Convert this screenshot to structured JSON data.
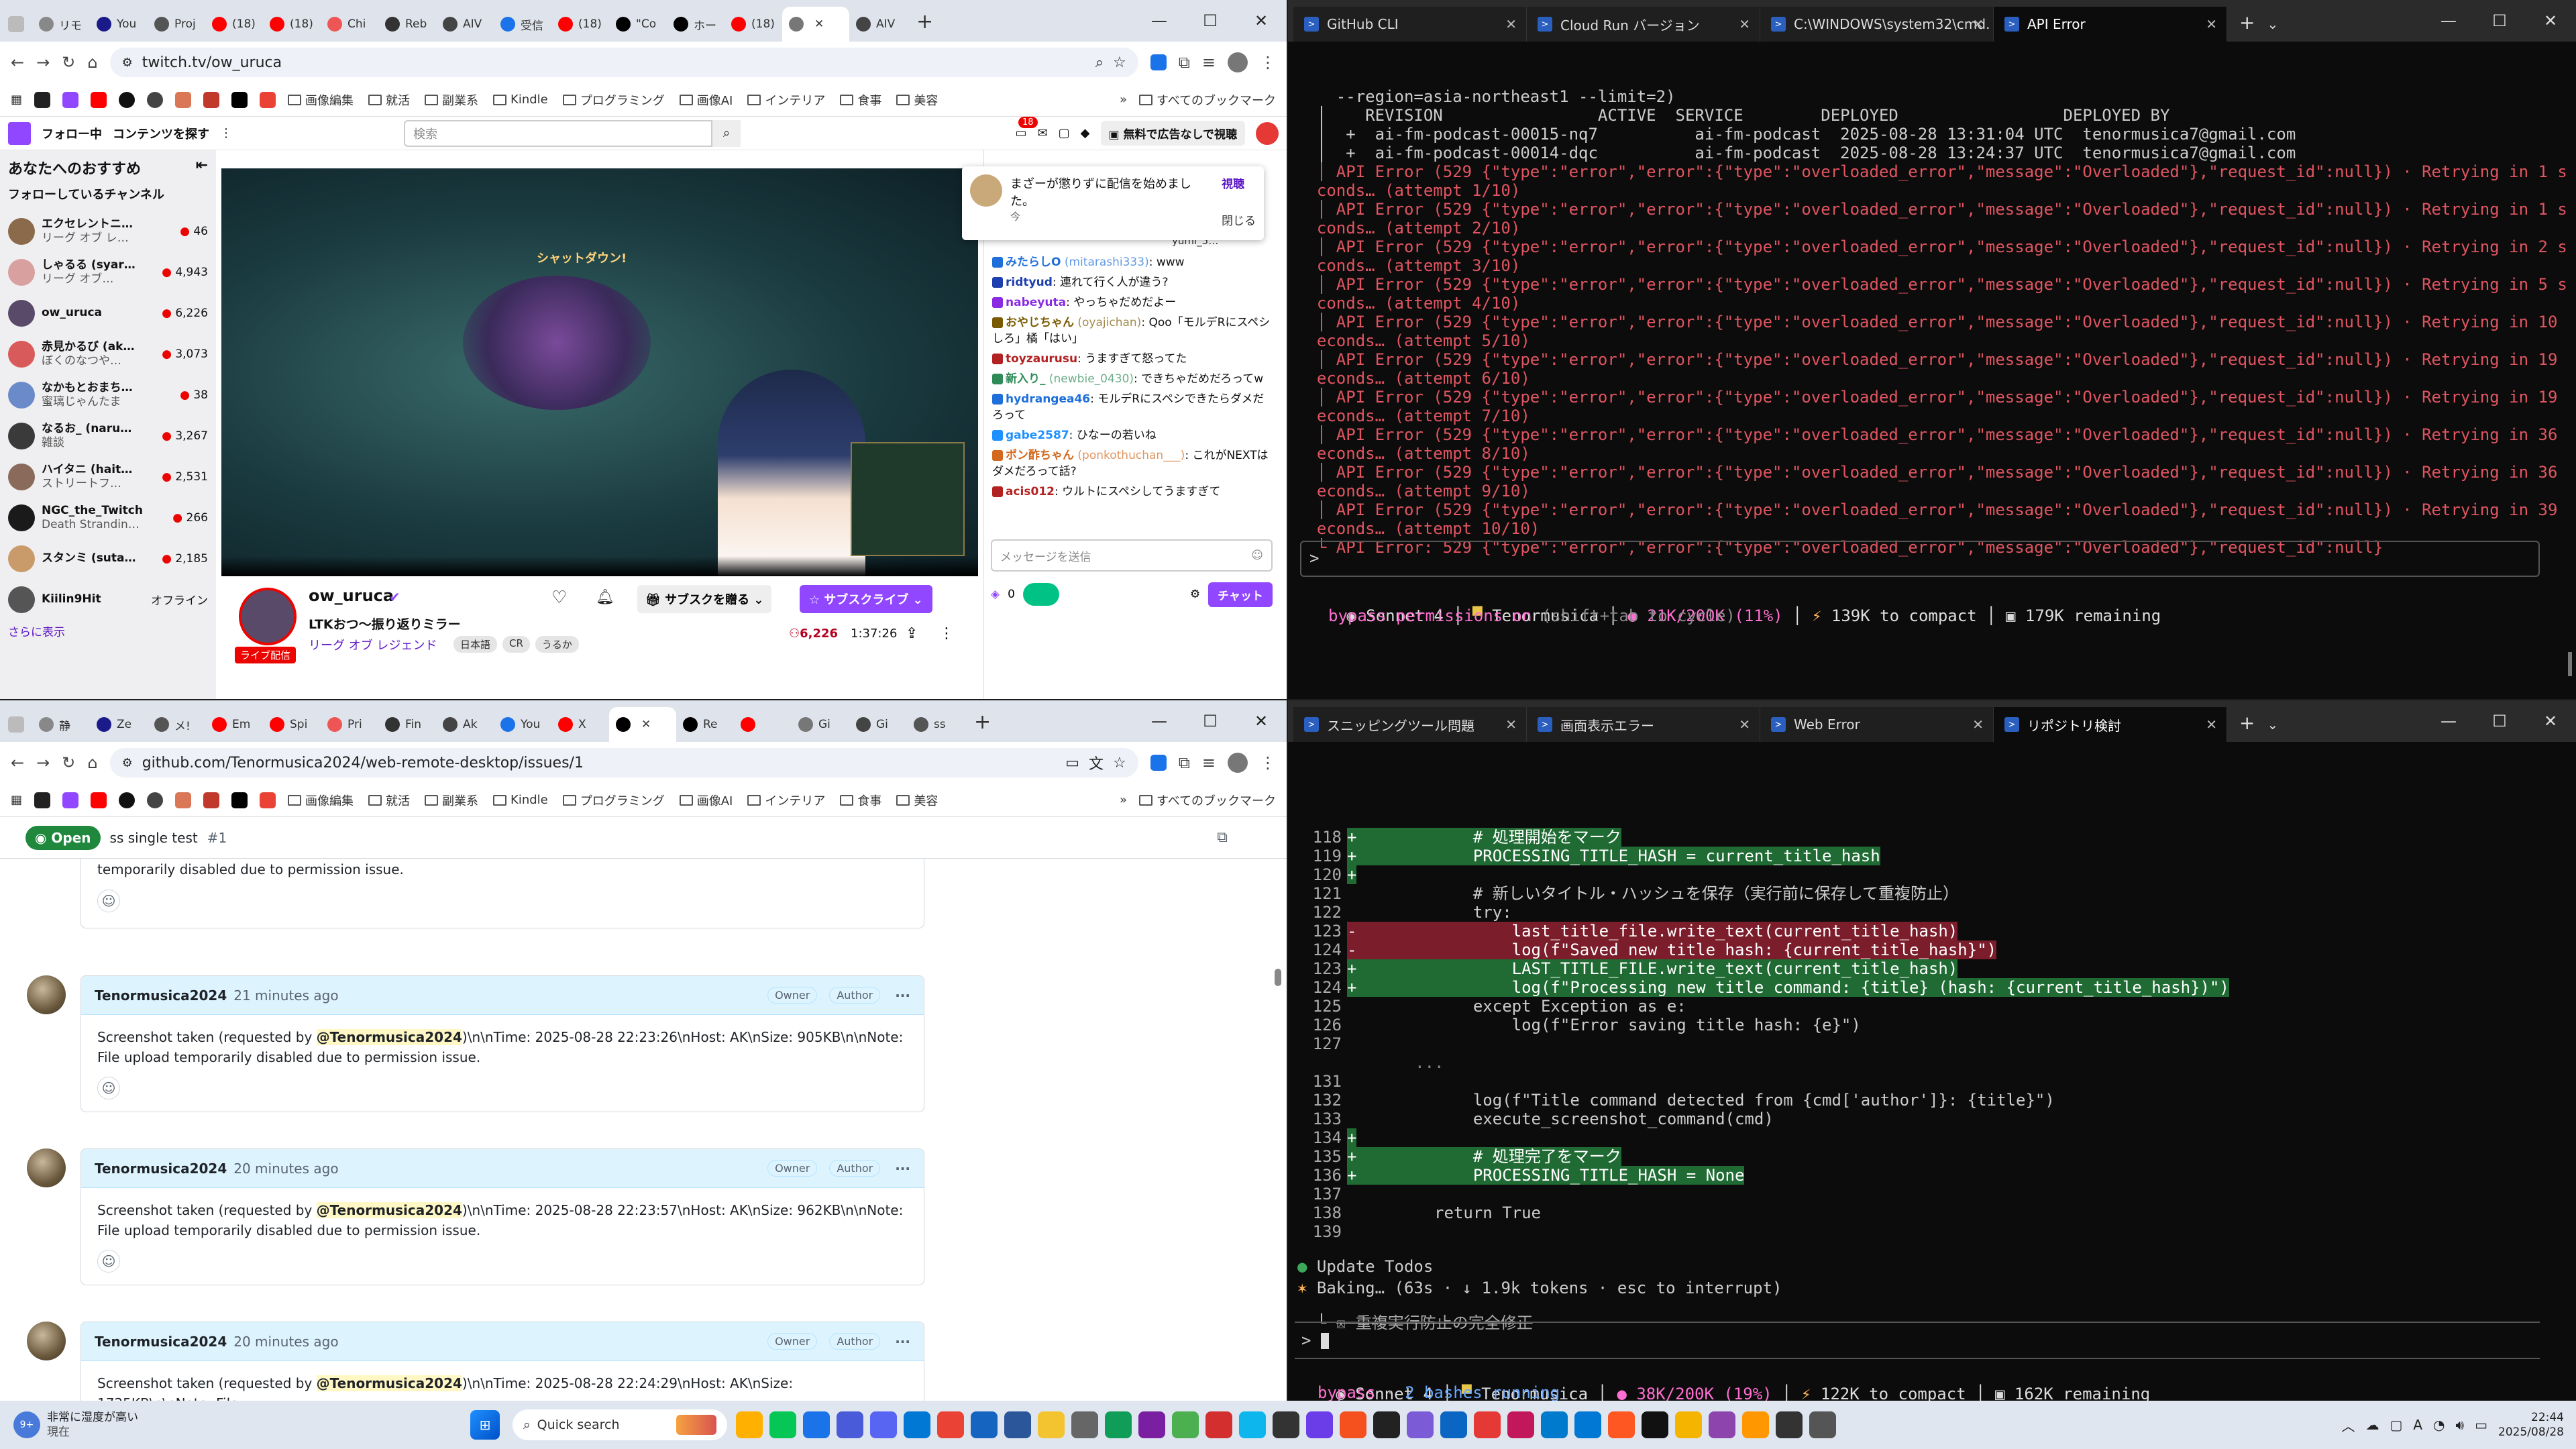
{
  "twitch_browser": {
    "tabs": [
      "リモ",
      "You",
      "Proj",
      "(18)",
      "(18)",
      "Chi",
      "Reb",
      "AIV",
      "受信",
      "(18)",
      "\"Co",
      "ホー",
      "(18)",
      "",
      "AIV"
    ],
    "url": "twitch.tv/ow_uruca",
    "bookmarks": [
      "画像編集",
      "就活",
      "副業系",
      "Kindle",
      "プログラミング",
      "画像AI",
      "インテリア",
      "食事",
      "美容"
    ],
    "all_bookmarks": "すべてのブックマーク",
    "following": "フォロー中",
    "browse": "コンテンツを探す",
    "search_placeholder": "検索",
    "notif_count": "18",
    "ad_free": "無料で広告なしで視聴",
    "recommended": "あなたへのおすすめ",
    "followed_channels": "フォローしているチャンネル",
    "channels": [
      {
        "name": "エクセレントニ…",
        "sub": "リーグ オブ レ…",
        "viewers": "46",
        "avatar": "#8a6a4a",
        "live": true
      },
      {
        "name": "しゃるる (syar…",
        "sub": "リーグ オブ…",
        "viewers": "4,943",
        "avatar": "#d9a0a0",
        "live": true
      },
      {
        "name": "ow_uruca",
        "sub": "",
        "viewers": "6,226",
        "avatar": "#5a4a6a",
        "live": true
      },
      {
        "name": "赤見かるび (ak…",
        "sub": "ぼくのなつや…",
        "viewers": "3,073",
        "avatar": "#d85a5a",
        "live": true
      },
      {
        "name": "なかもとおまち…",
        "sub": "蜜璃じゃんたま",
        "viewers": "38",
        "avatar": "#6a8ac9",
        "live": true
      },
      {
        "name": "なるお_ (naru…",
        "sub": "雑談",
        "viewers": "3,267",
        "avatar": "#3a3a3a",
        "live": true
      },
      {
        "name": "ハイタニ (hait…",
        "sub": "ストリートフ…",
        "viewers": "2,531",
        "avatar": "#8a6a5a",
        "live": true
      },
      {
        "name": "NGC_the_Twitch",
        "sub": "Death Strandin…",
        "viewers": "266",
        "avatar": "#1a1a1a",
        "live": true
      },
      {
        "name": "スタンミ (suta…",
        "sub": "",
        "viewers": "2,185",
        "avatar": "#c99a6a",
        "live": true
      },
      {
        "name": "Kiilin9Hit",
        "sub": "",
        "viewers": "オフライン",
        "avatar": "#555",
        "live": false
      }
    ],
    "show_more": "さらに表示",
    "popup": {
      "text": "まざーが懲りずに配信を始めました。",
      "time": "今",
      "watch": "視聴",
      "close": "閉じる"
    },
    "chat": [
      {
        "user": "みたらしO",
        "id": "(mitarashi333)",
        "msg": ": www",
        "color": "#1e6fd9"
      },
      {
        "user": "ridtyud",
        "id": "",
        "msg": ": 連れて行く人が違う?",
        "color": "#1e3fb0"
      },
      {
        "user": "nabeyuta",
        "id": "",
        "msg": ": やっちゃだめだよー",
        "color": "#8a2be2"
      },
      {
        "user": "おやじちゃん",
        "id": "(oyajichan)",
        "msg": ": Qoo「モルデRにスペシしろ」橘「はい」",
        "color": "#7a5a00"
      },
      {
        "user": "toyzaurusu",
        "id": "",
        "msg": ": うますぎて怒ってた",
        "color": "#b22222"
      },
      {
        "user": "新入り_",
        "id": "(newbie_0430)",
        "msg": ": できちゃだめだろってw",
        "color": "#2e8b57"
      },
      {
        "user": "hydrangea46",
        "id": "",
        "msg": ": モルデRにスペシできたらダメだろって",
        "color": "#1e6fd9"
      },
      {
        "user": "gabe2587",
        "id": "",
        "msg": ": ひなーの若いね",
        "color": "#1e90ff"
      },
      {
        "user": "ポン酢ちゃん",
        "id": "(ponkothuchan___)",
        "msg": ": これがNEXTはダメだろって話?",
        "color": "#d2691e"
      },
      {
        "user": "acis012",
        "id": "",
        "msg": ": ウルトにスペシしてうますぎて",
        "color": "#b22222"
      }
    ],
    "chat_top": "yumi_5…",
    "chat_placeholder": "メッセージを送信",
    "chat_points": "0",
    "chat_button": "チャット",
    "streamer": "ow_uruca",
    "stream_title": "LTKおつ〜振り返りミラー",
    "live_label": "ライブ配信",
    "category": "リーグ オブ レジェンド",
    "tags": [
      "日本語",
      "CR",
      "うるか"
    ],
    "viewers": "6,226",
    "uptime": "1:37:26",
    "gift_sub": "サブスクを贈る",
    "subscribe": "サブスクライブ",
    "game_text": "シャットダウン!"
  },
  "github_browser": {
    "tabs": [
      "静",
      "Ze",
      "メ!",
      "Em",
      "Spi",
      "Pri",
      "Fin",
      "Ak",
      "You",
      "X",
      "",
      "Re",
      "",
      "Gi",
      "Gi",
      "ss"
    ],
    "url": "github.com/Tenormusica2024/web-remote-desktop/issues/1",
    "issue_state": "Open",
    "issue_title": "ss single test",
    "issue_number": "#1",
    "partial_comment": "temporarily disabled due to permission issue.",
    "comments": [
      {
        "author": "Tenormusica2024",
        "time": "21 minutes ago",
        "owner": "Owner",
        "role": "Author",
        "mention": "@Tenormusica2024",
        "text_before": "Screenshot taken (requested by ",
        "text_after": ")\\n\\nTime: 2025-08-28 22:23:26\\nHost: AK\\nSize: 905KB\\n\\nNote: File upload temporarily disabled due to permission issue."
      },
      {
        "author": "Tenormusica2024",
        "time": "20 minutes ago",
        "owner": "Owner",
        "role": "Author",
        "mention": "@Tenormusica2024",
        "text_before": "Screenshot taken (requested by ",
        "text_after": ")\\n\\nTime: 2025-08-28 22:23:57\\nHost: AK\\nSize: 962KB\\n\\nNote: File upload temporarily disabled due to permission issue."
      },
      {
        "author": "Tenormusica2024",
        "time": "20 minutes ago",
        "owner": "Owner",
        "role": "Author",
        "mention": "@Tenormusica2024",
        "text_before": "Screenshot taken (requested by ",
        "text_after": ")\\n\\nTime: 2025-08-28 22:24:29\\nHost: AK\\nSize: 1725KB\\n\\nNote: File"
      }
    ]
  },
  "term_top": {
    "tabs": [
      "GitHub CLI",
      "Cloud Run バージョン",
      "C:\\WINDOWS\\system32\\cmd.",
      "API Error"
    ],
    "lines": [
      {
        "t": "    --region=asia-northeast1 --limit=2)",
        "c": ""
      },
      {
        "t": "  │    REVISION                ACTIVE  SERVICE        DEPLOYED                 DEPLOYED BY",
        "c": ""
      },
      {
        "t": "  │  +  ai-fm-podcast-00015-nq7          ai-fm-podcast  2025-08-28 13:31:04 UTC  tenormusica7@gmail.com",
        "c": ""
      },
      {
        "t": "  │  +  ai-fm-podcast-00014-dqc          ai-fm-podcast  2025-08-28 13:24:37 UTC  tenormusica7@gmail.com",
        "c": ""
      },
      {
        "t": "  │ API Error (529 {\"type\":\"error\",\"error\":{\"type\":\"overloaded_error\",\"message\":\"Overloaded\"},\"request_id\":null}) · Retrying in 1 se",
        "c": "red"
      },
      {
        "t": "  conds… (attempt 1/10)",
        "c": "red"
      },
      {
        "t": "  │ API Error (529 {\"type\":\"error\",\"error\":{\"type\":\"overloaded_error\",\"message\":\"Overloaded\"},\"request_id\":null}) · Retrying in 1 se",
        "c": "red"
      },
      {
        "t": "  conds… (attempt 2/10)",
        "c": "red"
      },
      {
        "t": "  │ API Error (529 {\"type\":\"error\",\"error\":{\"type\":\"overloaded_error\",\"message\":\"Overloaded\"},\"request_id\":null}) · Retrying in 2 se",
        "c": "red"
      },
      {
        "t": "  conds… (attempt 3/10)",
        "c": "red"
      },
      {
        "t": "  │ API Error (529 {\"type\":\"error\",\"error\":{\"type\":\"overloaded_error\",\"message\":\"Overloaded\"},\"request_id\":null}) · Retrying in 5 se",
        "c": "red"
      },
      {
        "t": "  conds… (attempt 4/10)",
        "c": "red"
      },
      {
        "t": "  │ API Error (529 {\"type\":\"error\",\"error\":{\"type\":\"overloaded_error\",\"message\":\"Overloaded\"},\"request_id\":null}) · Retrying in 10 s",
        "c": "red"
      },
      {
        "t": "  econds… (attempt 5/10)",
        "c": "red"
      },
      {
        "t": "  │ API Error (529 {\"type\":\"error\",\"error\":{\"type\":\"overloaded_error\",\"message\":\"Overloaded\"},\"request_id\":null}) · Retrying in 19 s",
        "c": "red"
      },
      {
        "t": "  econds… (attempt 6/10)",
        "c": "red"
      },
      {
        "t": "  │ API Error (529 {\"type\":\"error\",\"error\":{\"type\":\"overloaded_error\",\"message\":\"Overloaded\"},\"request_id\":null}) · Retrying in 19 s",
        "c": "red"
      },
      {
        "t": "  econds… (attempt 7/10)",
        "c": "red"
      },
      {
        "t": "  │ API Error (529 {\"type\":\"error\",\"error\":{\"type\":\"overloaded_error\",\"message\":\"Overloaded\"},\"request_id\":null}) · Retrying in 36 s",
        "c": "red"
      },
      {
        "t": "  econds… (attempt 8/10)",
        "c": "red"
      },
      {
        "t": "  │ API Error (529 {\"type\":\"error\",\"error\":{\"type\":\"overloaded_error\",\"message\":\"Overloaded\"},\"request_id\":null}) · Retrying in 36 s",
        "c": "red"
      },
      {
        "t": "  econds… (attempt 9/10)",
        "c": "red"
      },
      {
        "t": "  │ API Error (529 {\"type\":\"error\",\"error\":{\"type\":\"overloaded_error\",\"message\":\"Overloaded\"},\"request_id\":null}) · Retrying in 39 s",
        "c": "red"
      },
      {
        "t": "  econds… (attempt 10/10)",
        "c": "red"
      },
      {
        "t": "  └ API Error: 529 {\"type\":\"error\",\"error\":{\"type\":\"overloaded_error\",\"message\":\"Overloaded\"},\"request_id\":null}",
        "c": "red"
      }
    ],
    "prompt": ">",
    "status_model": "Sonnet 4",
    "status_dir": "Tenormusica",
    "status_ctx": "21K/200K (11%)",
    "status_compact": "139K to compact",
    "status_remaining": "179K remaining",
    "bypass": "bypass permissions on",
    "bypass_hint": "(shift+tab to cycle)"
  },
  "term_bottom": {
    "tabs": [
      "スニッピングツール問題",
      "画面表示エラー",
      "Web Error",
      "リポジトリ検討"
    ],
    "diff": [
      {
        "n": "118",
        "s": "+",
        "code": "            # 処理開始をマーク",
        "k": "add"
      },
      {
        "n": "119",
        "s": "+",
        "code": "            PROCESSING_TITLE_HASH = current_title_hash",
        "k": "add"
      },
      {
        "n": "120",
        "s": "+",
        "code": "",
        "k": "add"
      },
      {
        "n": "121",
        "s": " ",
        "code": "            # 新しいタイトル・ハッシュを保存（実行前に保存して重複防止）",
        "k": ""
      },
      {
        "n": "122",
        "s": " ",
        "code": "            try:",
        "k": ""
      },
      {
        "n": "123",
        "s": "-",
        "code": "                last_title_file.write_text(current_title_hash)",
        "k": "del"
      },
      {
        "n": "124",
        "s": "-",
        "code": "                log(f\"Saved new title hash: {current_title_hash}\")",
        "k": "del"
      },
      {
        "n": "123",
        "s": "+",
        "code": "                LAST_TITLE_FILE.write_text(current_title_hash)",
        "k": "add"
      },
      {
        "n": "124",
        "s": "+",
        "code": "                log(f\"Processing new title command: {title} (hash: {current_title_hash})\")",
        "k": "add"
      },
      {
        "n": "125",
        "s": " ",
        "code": "            except Exception as e:",
        "k": ""
      },
      {
        "n": "126",
        "s": " ",
        "code": "                log(f\"Error saving title hash: {e}\")",
        "k": ""
      },
      {
        "n": "127",
        "s": " ",
        "code": "",
        "k": ""
      },
      {
        "n": "",
        "s": "",
        "code": "       ...",
        "k": "gap"
      },
      {
        "n": "131",
        "s": " ",
        "code": "",
        "k": ""
      },
      {
        "n": "132",
        "s": " ",
        "code": "            log(f\"Title command detected from {cmd['author']}: {title}\")",
        "k": ""
      },
      {
        "n": "133",
        "s": " ",
        "code": "            execute_screenshot_command(cmd)",
        "k": ""
      },
      {
        "n": "134",
        "s": "+",
        "code": "",
        "k": "add"
      },
      {
        "n": "135",
        "s": "+",
        "code": "            # 処理完了をマーク",
        "k": "add"
      },
      {
        "n": "136",
        "s": "+",
        "code": "            PROCESSING_TITLE_HASH = None",
        "k": "add"
      },
      {
        "n": "137",
        "s": " ",
        "code": "",
        "k": ""
      },
      {
        "n": "138",
        "s": " ",
        "code": "        return True",
        "k": ""
      },
      {
        "n": "139",
        "s": " ",
        "code": "",
        "k": ""
      }
    ],
    "todos_title": "Update Todos",
    "todo_item": "☒ 重複実行防止の完全修正",
    "baking": "Baking… (63s · ↓ 1.9k tokens · esc to interrupt)",
    "prompt": ">",
    "status_model": "Sonnet 4",
    "status_dir": "Tenormusica",
    "status_ctx": "38K/200K (19%)",
    "status_compact": "122K to compact",
    "status_remaining": "162K remaining",
    "bypass": "bypass",
    "bypass_hint": "2 bashes running"
  },
  "taskbar": {
    "weather_temp": "9+",
    "weather_title": "非常に湿度が高い",
    "weather_sub": "現在",
    "search": "Quick search",
    "time": "22:44",
    "date": "2025/08/28",
    "ime_a": "A"
  },
  "colors": {
    "twitch": "#9146ff",
    "github_green": "#1f883d",
    "term_red": "#e05561",
    "diff_add": "#1f6b33",
    "diff_del": "#7c1d2c"
  }
}
